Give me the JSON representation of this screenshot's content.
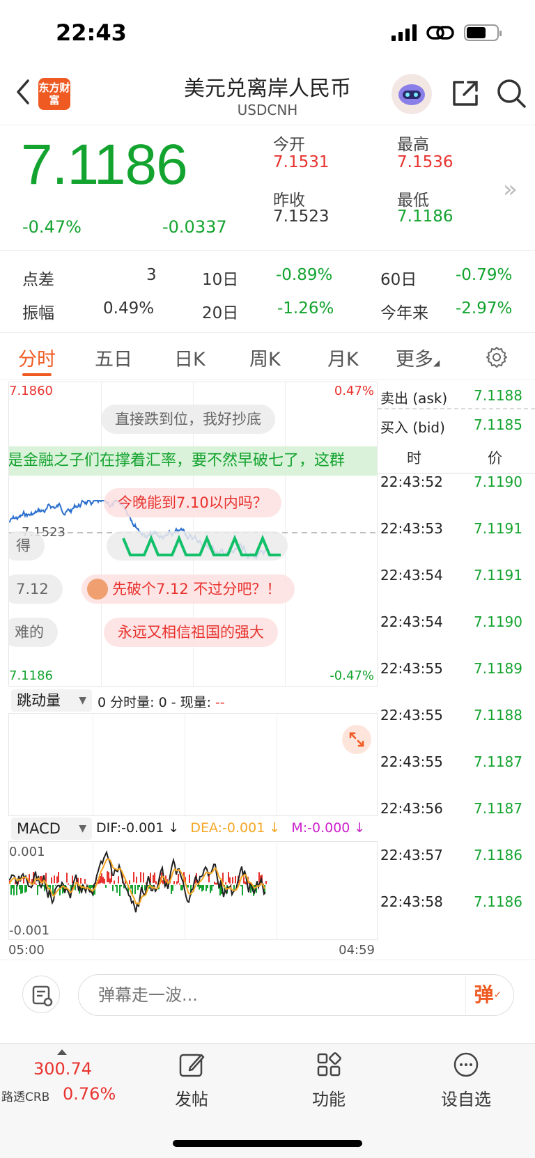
{
  "status": {
    "time": "22:43"
  },
  "nav": {
    "title": "美元兑离岸人民币",
    "subtitle": "USDCNH",
    "logo_text": "东方财富"
  },
  "quote": {
    "price": "7.1186",
    "change_pct": "-0.47%",
    "change_val": "-0.0337",
    "open_label": "今开",
    "open": "7.1531",
    "high_label": "最高",
    "high": "7.1536",
    "prev_close_label": "昨收",
    "prev_close": "7.1523",
    "low_label": "最低",
    "low": "7.1186",
    "colors": {
      "up": "#e8322e",
      "down": "#13a32f"
    }
  },
  "stats": {
    "spread_label": "点差",
    "spread": "3",
    "d10_label": "10日",
    "d10": "-0.89%",
    "d60_label": "60日",
    "d60": "-0.79%",
    "amp_label": "振幅",
    "amp": "0.49%",
    "d20_label": "20日",
    "d20": "-1.26%",
    "ytd_label": "今年来",
    "ytd": "-2.97%"
  },
  "tabs": [
    {
      "label": "分时",
      "active": true
    },
    {
      "label": "五日"
    },
    {
      "label": "日K"
    },
    {
      "label": "周K"
    },
    {
      "label": "月K"
    },
    {
      "label": "更多"
    }
  ],
  "chart": {
    "top_price": "7.1860",
    "top_pct": "0.47%",
    "bottom_price": "7.1186",
    "bottom_pct": "-0.47%",
    "mid_price": "7.1523",
    "danmu": [
      "直接跌到位，我好抄底",
      "是金融之子们在撑着汇率，要不然早破七了，这群",
      "今晚能到7.10以内吗？",
      "得",
      "7.12",
      "先破个7.12 不过分吧？！",
      "难的",
      "永远又相信祖国的强大"
    ],
    "start_time": "05:00",
    "end_time": "04:59"
  },
  "volume": {
    "dropdown": "跳动量",
    "info_prefix": "0 分时量: 0 - 现量: ",
    "info_dash": "--"
  },
  "macd": {
    "dropdown": "MACD",
    "dif": "DIF:-0.001 ↓",
    "dea": "DEA:-0.001 ↓",
    "m": "M:-0.000 ↓",
    "top": "0.001",
    "bottom": "-0.001",
    "colors": {
      "dea": "#f5a623",
      "m": "#cc22cc"
    }
  },
  "side": {
    "ask_label": "卖出 (ask)",
    "ask": "7.1188",
    "bid_label": "买入 (bid)",
    "bid": "7.1185",
    "time_header": "时",
    "price_header": "价",
    "ticks": [
      {
        "t": "22:43:52",
        "p": "7.1190"
      },
      {
        "t": "22:43:53",
        "p": "7.1191"
      },
      {
        "t": "22:43:54",
        "p": "7.1191"
      },
      {
        "t": "22:43:54",
        "p": "7.1190"
      },
      {
        "t": "22:43:55",
        "p": "7.1189"
      },
      {
        "t": "22:43:55",
        "p": "7.1188"
      },
      {
        "t": "22:43:55",
        "p": "7.1187"
      },
      {
        "t": "22:43:56",
        "p": "7.1187"
      },
      {
        "t": "22:43:57",
        "p": "7.1186"
      },
      {
        "t": "22:43:58",
        "p": "7.1186"
      }
    ]
  },
  "input": {
    "placeholder": "弹幕走一波...",
    "danmu_btn": "弹"
  },
  "bottom": {
    "crb_value": "300.74",
    "crb_name": "路透CRB",
    "crb_pct": "0.76%",
    "post": "发帖",
    "func": "功能",
    "watch": "设自选"
  }
}
